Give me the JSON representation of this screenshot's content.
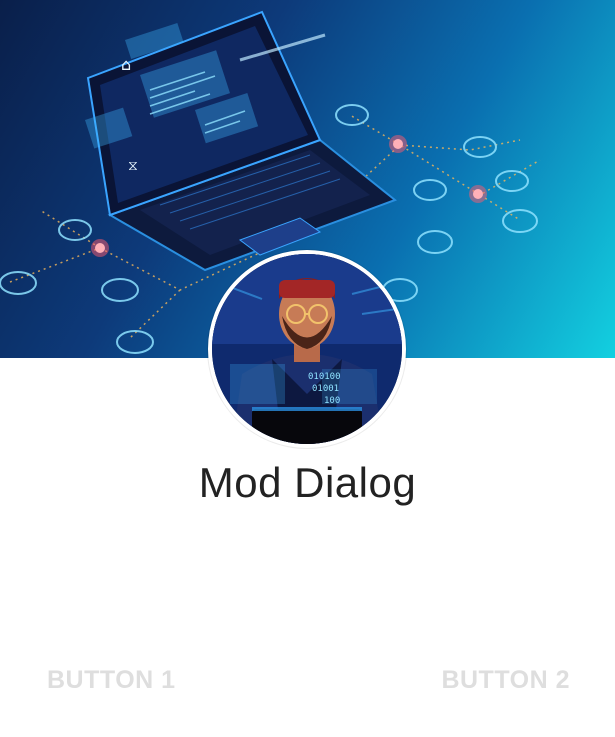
{
  "dialog": {
    "title": "Mod Dialog",
    "button_1_label": "BUTTON 1",
    "button_2_label": "BUTTON 2",
    "header_image": "laptop-tech-illustration",
    "avatar_image": "developer-avatar-illustration"
  },
  "colors": {
    "button_text": "#dedede",
    "title_text": "#222222",
    "header_gradient_start": "#0a1f4a",
    "header_gradient_end": "#13d0e0",
    "accent_node": "#ff5a6e"
  }
}
